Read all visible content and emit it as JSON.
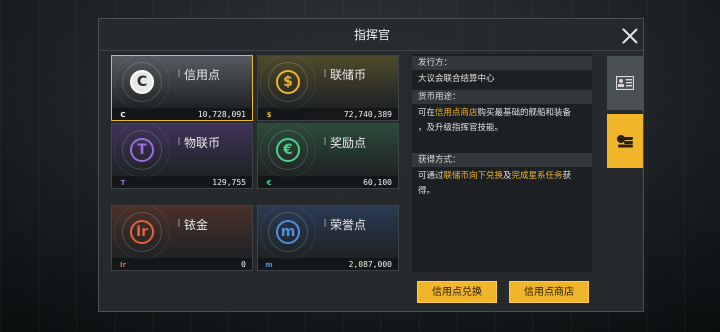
{
  "panel": {
    "title": "指挥官"
  },
  "currencies": [
    {
      "name": "信用点",
      "amount": "10,728,091",
      "coin_letter": "C",
      "color": "#ffffff",
      "glow": "#555b60",
      "icon": "credit-coin-icon",
      "selected": true
    },
    {
      "name": "联储币",
      "amount": "72,740,389",
      "coin_letter": "$",
      "color": "#f0b52b",
      "glow": "#4f4a2a",
      "icon": "reserve-coin-icon",
      "selected": false
    },
    {
      "name": "物联币",
      "amount": "129,755",
      "coin_letter": "T",
      "color": "#9b6ee0",
      "glow": "#3f3358",
      "icon": "iot-coin-icon",
      "selected": false
    },
    {
      "name": "奖励点",
      "amount": "60,100",
      "coin_letter": "€",
      "color": "#4fcf8a",
      "glow": "#2c4a3a",
      "icon": "reward-coin-icon",
      "selected": false
    },
    {
      "name": "铱金",
      "amount": "0",
      "coin_letter": "Ir",
      "color": "#e2633a",
      "glow": "#4a3129",
      "icon": "iridium-coin-icon",
      "selected": false
    },
    {
      "name": "荣誉点",
      "amount": "2,087,000",
      "coin_letter": "m",
      "color": "#4f8fe0",
      "glow": "#2a3a52",
      "icon": "honor-coin-icon",
      "selected": false
    }
  ],
  "description": {
    "issuer_label": "发行方：",
    "issuer_text": "大议会联合结算中心",
    "usage_label": "货币用途：",
    "usage_pre": "可在",
    "usage_link": "信用点商店",
    "usage_post": "购买最基础的舰船和装备",
    "usage_line2": "，及升级指挥官技能。",
    "obtain_label": "获得方式：",
    "obtain_pre": "可通过",
    "obtain_link1": "联储币向下兑换",
    "obtain_mid": "及",
    "obtain_link2": "完成星系任务",
    "obtain_post": "获",
    "obtain_line2": "得。"
  },
  "tabs": [
    {
      "name": "profile-tab",
      "icon": "profile-card-icon",
      "active": false
    },
    {
      "name": "currency-tab",
      "icon": "coin-stack-icon",
      "active": true
    }
  ],
  "buttons": {
    "exchange": "信用点兑换",
    "shop": "信用点商店"
  },
  "colors": {
    "accent": "#f0b52b"
  }
}
